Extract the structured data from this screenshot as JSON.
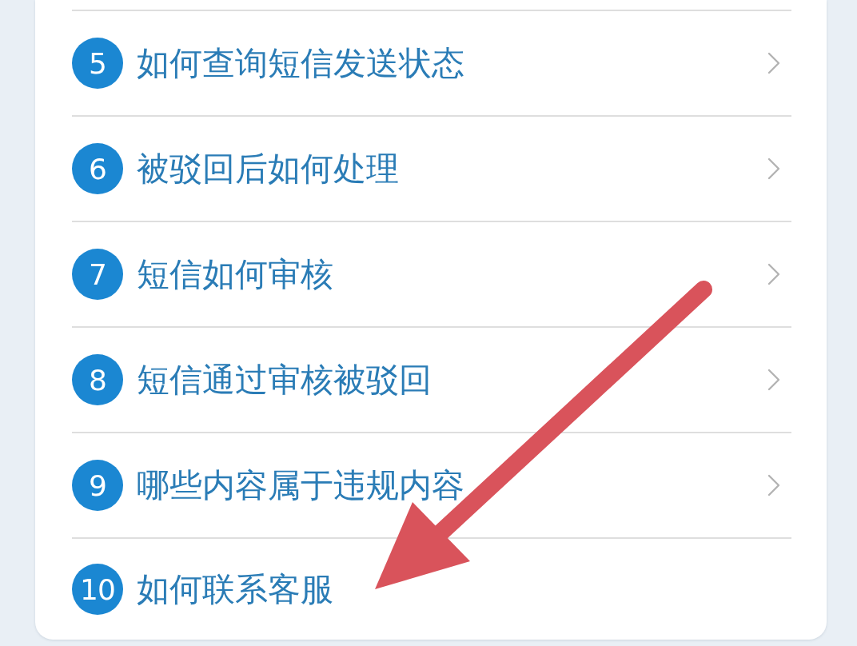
{
  "faq_list": {
    "items": [
      {
        "number": "5",
        "title": "如何查询短信发送状态",
        "chevron": true
      },
      {
        "number": "6",
        "title": "被驳回后如何处理",
        "chevron": true
      },
      {
        "number": "7",
        "title": "短信如何审核",
        "chevron": true
      },
      {
        "number": "8",
        "title": "短信通过审核被驳回",
        "chevron": true
      },
      {
        "number": "9",
        "title": "哪些内容属于违规内容",
        "chevron": true
      },
      {
        "number": "10",
        "title": "如何联系客服",
        "chevron": false
      }
    ]
  }
}
